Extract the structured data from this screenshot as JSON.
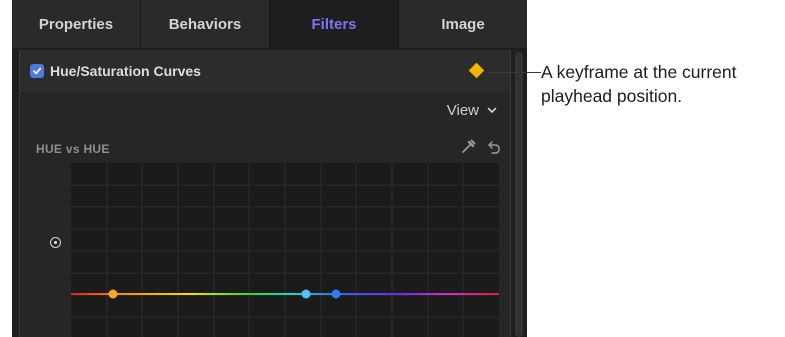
{
  "tabs": [
    {
      "label": "Properties",
      "active": false
    },
    {
      "label": "Behaviors",
      "active": false
    },
    {
      "label": "Filters",
      "active": true
    },
    {
      "label": "Image",
      "active": false
    }
  ],
  "filter": {
    "name": "Hue/Saturation Curves",
    "enabled": true,
    "view_label": "View",
    "curve_label": "HUE vs HUE"
  },
  "callout": {
    "text": "A keyframe at the current playhead position."
  },
  "colors": {
    "accent": "#7a76f2",
    "checkbox": "#4b7be0",
    "keyframe": "#f5b400",
    "point_orange": "#f5a623",
    "point_blue": "#3a9ff2"
  },
  "icons": [
    "checkmark-icon",
    "keyframe-icon",
    "chevron-down-icon",
    "eyedropper-icon",
    "reset-icon",
    "target-icon"
  ]
}
